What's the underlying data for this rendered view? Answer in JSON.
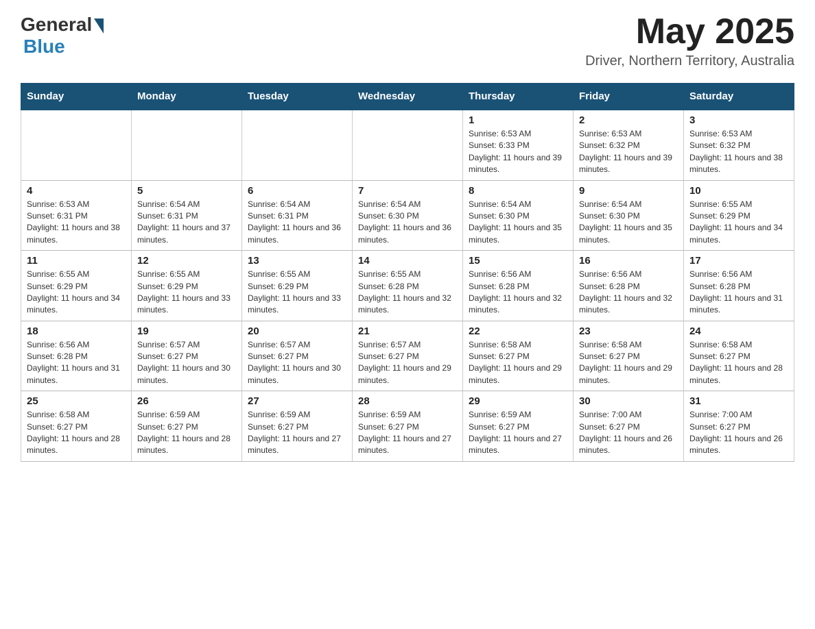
{
  "header": {
    "logo_general": "General",
    "logo_blue": "Blue",
    "month_title": "May 2025",
    "location": "Driver, Northern Territory, Australia"
  },
  "weekdays": [
    "Sunday",
    "Monday",
    "Tuesday",
    "Wednesday",
    "Thursday",
    "Friday",
    "Saturday"
  ],
  "weeks": [
    [
      {
        "day": "",
        "sunrise": "",
        "sunset": "",
        "daylight": ""
      },
      {
        "day": "",
        "sunrise": "",
        "sunset": "",
        "daylight": ""
      },
      {
        "day": "",
        "sunrise": "",
        "sunset": "",
        "daylight": ""
      },
      {
        "day": "",
        "sunrise": "",
        "sunset": "",
        "daylight": ""
      },
      {
        "day": "1",
        "sunrise": "Sunrise: 6:53 AM",
        "sunset": "Sunset: 6:33 PM",
        "daylight": "Daylight: 11 hours and 39 minutes."
      },
      {
        "day": "2",
        "sunrise": "Sunrise: 6:53 AM",
        "sunset": "Sunset: 6:32 PM",
        "daylight": "Daylight: 11 hours and 39 minutes."
      },
      {
        "day": "3",
        "sunrise": "Sunrise: 6:53 AM",
        "sunset": "Sunset: 6:32 PM",
        "daylight": "Daylight: 11 hours and 38 minutes."
      }
    ],
    [
      {
        "day": "4",
        "sunrise": "Sunrise: 6:53 AM",
        "sunset": "Sunset: 6:31 PM",
        "daylight": "Daylight: 11 hours and 38 minutes."
      },
      {
        "day": "5",
        "sunrise": "Sunrise: 6:54 AM",
        "sunset": "Sunset: 6:31 PM",
        "daylight": "Daylight: 11 hours and 37 minutes."
      },
      {
        "day": "6",
        "sunrise": "Sunrise: 6:54 AM",
        "sunset": "Sunset: 6:31 PM",
        "daylight": "Daylight: 11 hours and 36 minutes."
      },
      {
        "day": "7",
        "sunrise": "Sunrise: 6:54 AM",
        "sunset": "Sunset: 6:30 PM",
        "daylight": "Daylight: 11 hours and 36 minutes."
      },
      {
        "day": "8",
        "sunrise": "Sunrise: 6:54 AM",
        "sunset": "Sunset: 6:30 PM",
        "daylight": "Daylight: 11 hours and 35 minutes."
      },
      {
        "day": "9",
        "sunrise": "Sunrise: 6:54 AM",
        "sunset": "Sunset: 6:30 PM",
        "daylight": "Daylight: 11 hours and 35 minutes."
      },
      {
        "day": "10",
        "sunrise": "Sunrise: 6:55 AM",
        "sunset": "Sunset: 6:29 PM",
        "daylight": "Daylight: 11 hours and 34 minutes."
      }
    ],
    [
      {
        "day": "11",
        "sunrise": "Sunrise: 6:55 AM",
        "sunset": "Sunset: 6:29 PM",
        "daylight": "Daylight: 11 hours and 34 minutes."
      },
      {
        "day": "12",
        "sunrise": "Sunrise: 6:55 AM",
        "sunset": "Sunset: 6:29 PM",
        "daylight": "Daylight: 11 hours and 33 minutes."
      },
      {
        "day": "13",
        "sunrise": "Sunrise: 6:55 AM",
        "sunset": "Sunset: 6:29 PM",
        "daylight": "Daylight: 11 hours and 33 minutes."
      },
      {
        "day": "14",
        "sunrise": "Sunrise: 6:55 AM",
        "sunset": "Sunset: 6:28 PM",
        "daylight": "Daylight: 11 hours and 32 minutes."
      },
      {
        "day": "15",
        "sunrise": "Sunrise: 6:56 AM",
        "sunset": "Sunset: 6:28 PM",
        "daylight": "Daylight: 11 hours and 32 minutes."
      },
      {
        "day": "16",
        "sunrise": "Sunrise: 6:56 AM",
        "sunset": "Sunset: 6:28 PM",
        "daylight": "Daylight: 11 hours and 32 minutes."
      },
      {
        "day": "17",
        "sunrise": "Sunrise: 6:56 AM",
        "sunset": "Sunset: 6:28 PM",
        "daylight": "Daylight: 11 hours and 31 minutes."
      }
    ],
    [
      {
        "day": "18",
        "sunrise": "Sunrise: 6:56 AM",
        "sunset": "Sunset: 6:28 PM",
        "daylight": "Daylight: 11 hours and 31 minutes."
      },
      {
        "day": "19",
        "sunrise": "Sunrise: 6:57 AM",
        "sunset": "Sunset: 6:27 PM",
        "daylight": "Daylight: 11 hours and 30 minutes."
      },
      {
        "day": "20",
        "sunrise": "Sunrise: 6:57 AM",
        "sunset": "Sunset: 6:27 PM",
        "daylight": "Daylight: 11 hours and 30 minutes."
      },
      {
        "day": "21",
        "sunrise": "Sunrise: 6:57 AM",
        "sunset": "Sunset: 6:27 PM",
        "daylight": "Daylight: 11 hours and 29 minutes."
      },
      {
        "day": "22",
        "sunrise": "Sunrise: 6:58 AM",
        "sunset": "Sunset: 6:27 PM",
        "daylight": "Daylight: 11 hours and 29 minutes."
      },
      {
        "day": "23",
        "sunrise": "Sunrise: 6:58 AM",
        "sunset": "Sunset: 6:27 PM",
        "daylight": "Daylight: 11 hours and 29 minutes."
      },
      {
        "day": "24",
        "sunrise": "Sunrise: 6:58 AM",
        "sunset": "Sunset: 6:27 PM",
        "daylight": "Daylight: 11 hours and 28 minutes."
      }
    ],
    [
      {
        "day": "25",
        "sunrise": "Sunrise: 6:58 AM",
        "sunset": "Sunset: 6:27 PM",
        "daylight": "Daylight: 11 hours and 28 minutes."
      },
      {
        "day": "26",
        "sunrise": "Sunrise: 6:59 AM",
        "sunset": "Sunset: 6:27 PM",
        "daylight": "Daylight: 11 hours and 28 minutes."
      },
      {
        "day": "27",
        "sunrise": "Sunrise: 6:59 AM",
        "sunset": "Sunset: 6:27 PM",
        "daylight": "Daylight: 11 hours and 27 minutes."
      },
      {
        "day": "28",
        "sunrise": "Sunrise: 6:59 AM",
        "sunset": "Sunset: 6:27 PM",
        "daylight": "Daylight: 11 hours and 27 minutes."
      },
      {
        "day": "29",
        "sunrise": "Sunrise: 6:59 AM",
        "sunset": "Sunset: 6:27 PM",
        "daylight": "Daylight: 11 hours and 27 minutes."
      },
      {
        "day": "30",
        "sunrise": "Sunrise: 7:00 AM",
        "sunset": "Sunset: 6:27 PM",
        "daylight": "Daylight: 11 hours and 26 minutes."
      },
      {
        "day": "31",
        "sunrise": "Sunrise: 7:00 AM",
        "sunset": "Sunset: 6:27 PM",
        "daylight": "Daylight: 11 hours and 26 minutes."
      }
    ]
  ]
}
